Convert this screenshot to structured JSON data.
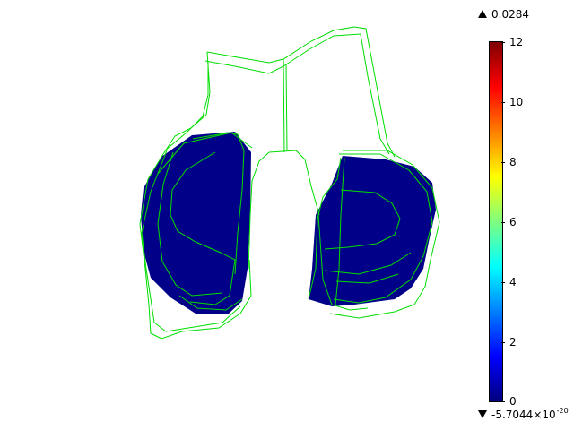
{
  "plot": {
    "max_label": "0.0284",
    "min_mantissa": "-5.7044×10",
    "min_exponent": "-20",
    "max_icon": "triangle-up-icon",
    "min_icon": "triangle-down-icon"
  },
  "colorbar": {
    "ticks": [
      "12",
      "10",
      "8",
      "6",
      "4",
      "2",
      "0"
    ],
    "colors": [
      "#00007f",
      "#0000ff",
      "#007fff",
      "#00ffff",
      "#7fff7f",
      "#ffff00",
      "#ff7f00",
      "#ff0000",
      "#7f0000"
    ]
  },
  "colors": {
    "surface_fill": "#000088",
    "edge_lines": "#00dd00"
  }
}
